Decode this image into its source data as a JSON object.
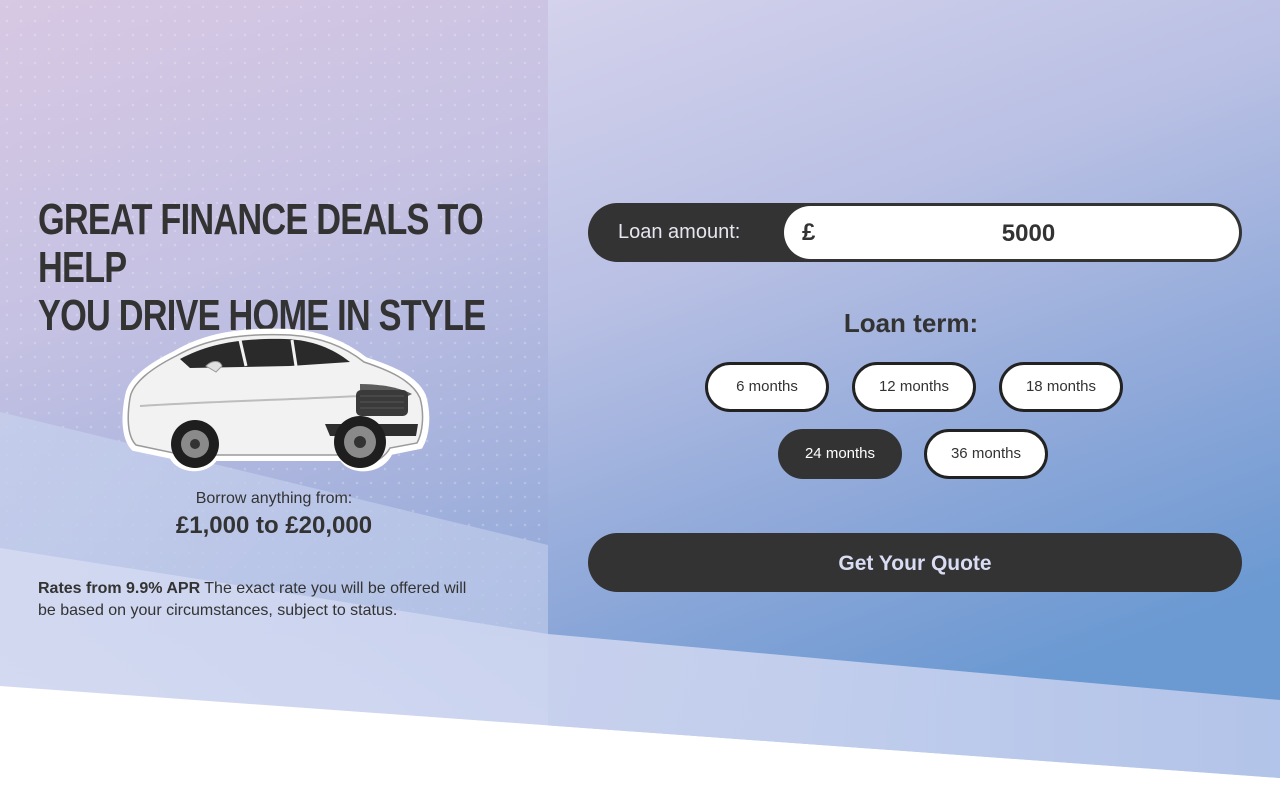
{
  "hero": {
    "headline_line1": "GREAT FINANCE DEALS TO HELP",
    "headline_line2": "YOU DRIVE HOME IN STYLE",
    "borrow_label": "Borrow anything from:",
    "borrow_range": "£1,000 to £20,000",
    "rates_bold": "Rates from 9.9% APR",
    "rates_text": " The exact rate you will be offered will be based on your circumstances, subject to status."
  },
  "form": {
    "loan_amount_label": "Loan amount:",
    "currency_symbol": "£",
    "loan_amount_value": "5000",
    "loan_term_title": "Loan term:",
    "terms": [
      {
        "label": "6 months",
        "selected": false
      },
      {
        "label": "12 months",
        "selected": false
      },
      {
        "label": "18 months",
        "selected": false
      },
      {
        "label": "24 months",
        "selected": true
      },
      {
        "label": "36 months",
        "selected": false
      }
    ],
    "quote_button": "Get Your Quote"
  },
  "colors": {
    "dark": "#333333",
    "accent_text": "#d9dcf2"
  },
  "icons": {
    "car": "white-electric-suv-image"
  }
}
